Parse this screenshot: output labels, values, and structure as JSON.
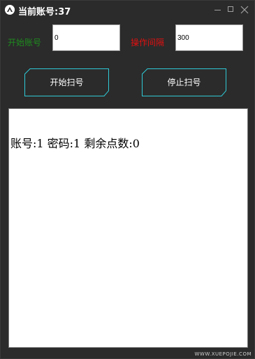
{
  "window": {
    "title": "当前账号:37",
    "controls": {
      "minimize_icon": "minimize-icon",
      "maximize_icon": "maximize-icon",
      "close_icon": "close-icon"
    }
  },
  "form": {
    "start_account_label": "开始账号",
    "start_account_value": "0",
    "interval_label": "操作间隔",
    "interval_value": "300"
  },
  "buttons": {
    "start_scan": "开始扫号",
    "stop_scan": "停止扫号"
  },
  "log": {
    "lines": [
      "账号:1 密码:1 剩余点数:0"
    ]
  },
  "watermark": "WWW.XUEPOJIE.COM",
  "colors": {
    "background": "#2b2b2b",
    "start_label": "#1f8a1f",
    "interval_label": "#e01010",
    "button_border": "#2fc9d6",
    "text_light": "#ffffff"
  }
}
